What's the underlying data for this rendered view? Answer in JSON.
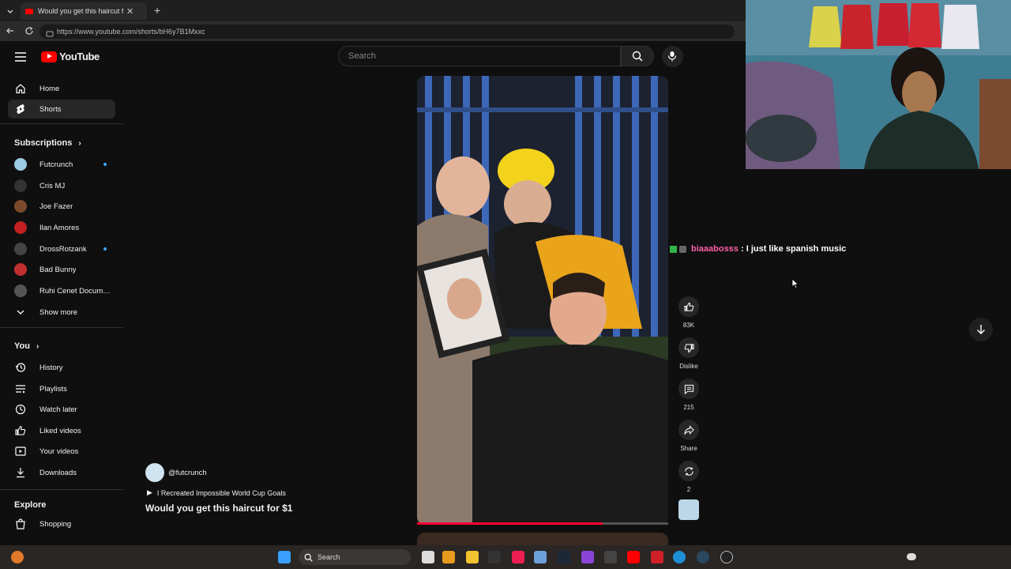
{
  "browser": {
    "tab_title": "Would you get this haircut for $1",
    "url": "https://www.youtube.com/shorts/bH6y7B1Mxxc"
  },
  "masthead": {
    "logo_text": "YouTube",
    "search_placeholder": "Search"
  },
  "sidebar": {
    "nav": [
      {
        "label": "Home",
        "icon": "home-icon"
      },
      {
        "label": "Shorts",
        "icon": "shorts-icon"
      }
    ],
    "subscriptions_header": "Subscriptions",
    "subscriptions": [
      {
        "label": "Futcrunch",
        "new": true,
        "color": "#9ccbe4"
      },
      {
        "label": "Cris MJ",
        "new": false,
        "color": "#333333"
      },
      {
        "label": "Joe Fazer",
        "new": false,
        "color": "#7a4a2a"
      },
      {
        "label": "Ilan Amores",
        "new": false,
        "color": "#c02020"
      },
      {
        "label": "DrossRotzank",
        "new": true,
        "color": "#444444"
      },
      {
        "label": "Bad Bunny",
        "new": false,
        "color": "#c03030"
      },
      {
        "label": "Ruhi Cenet Docume...",
        "new": false,
        "color": "#555555"
      }
    ],
    "show_more": "Show more",
    "you_header": "You",
    "you_items": [
      {
        "label": "History",
        "icon": "history-icon"
      },
      {
        "label": "Playlists",
        "icon": "playlists-icon"
      },
      {
        "label": "Watch later",
        "icon": "watch-later-icon"
      },
      {
        "label": "Liked videos",
        "icon": "liked-videos-icon"
      },
      {
        "label": "Your videos",
        "icon": "your-videos-icon"
      },
      {
        "label": "Downloads",
        "icon": "downloads-icon"
      }
    ],
    "explore_header": "Explore",
    "explore_items": [
      {
        "label": "Shopping",
        "icon": "shopping-icon"
      }
    ]
  },
  "short": {
    "channel": "@futcrunch",
    "playlist": "I Recreated Impossible World Cup Goals",
    "title": "Would you get this haircut for $1",
    "progress": 0.74
  },
  "actions": {
    "likes": "83K",
    "dislike": "Dislike",
    "comments": "215",
    "share": "Share",
    "remix": "2"
  },
  "chat": {
    "user": "biaaabosss",
    "separator": " : ",
    "message": "I just like spanish music"
  },
  "taskbar": {
    "search_placeholder": "Search"
  },
  "colors": {
    "brand_red": "#ff0000",
    "background": "#0f0f0f",
    "progress_red": "#ff0033",
    "chat_user": "#ff5fa8"
  }
}
